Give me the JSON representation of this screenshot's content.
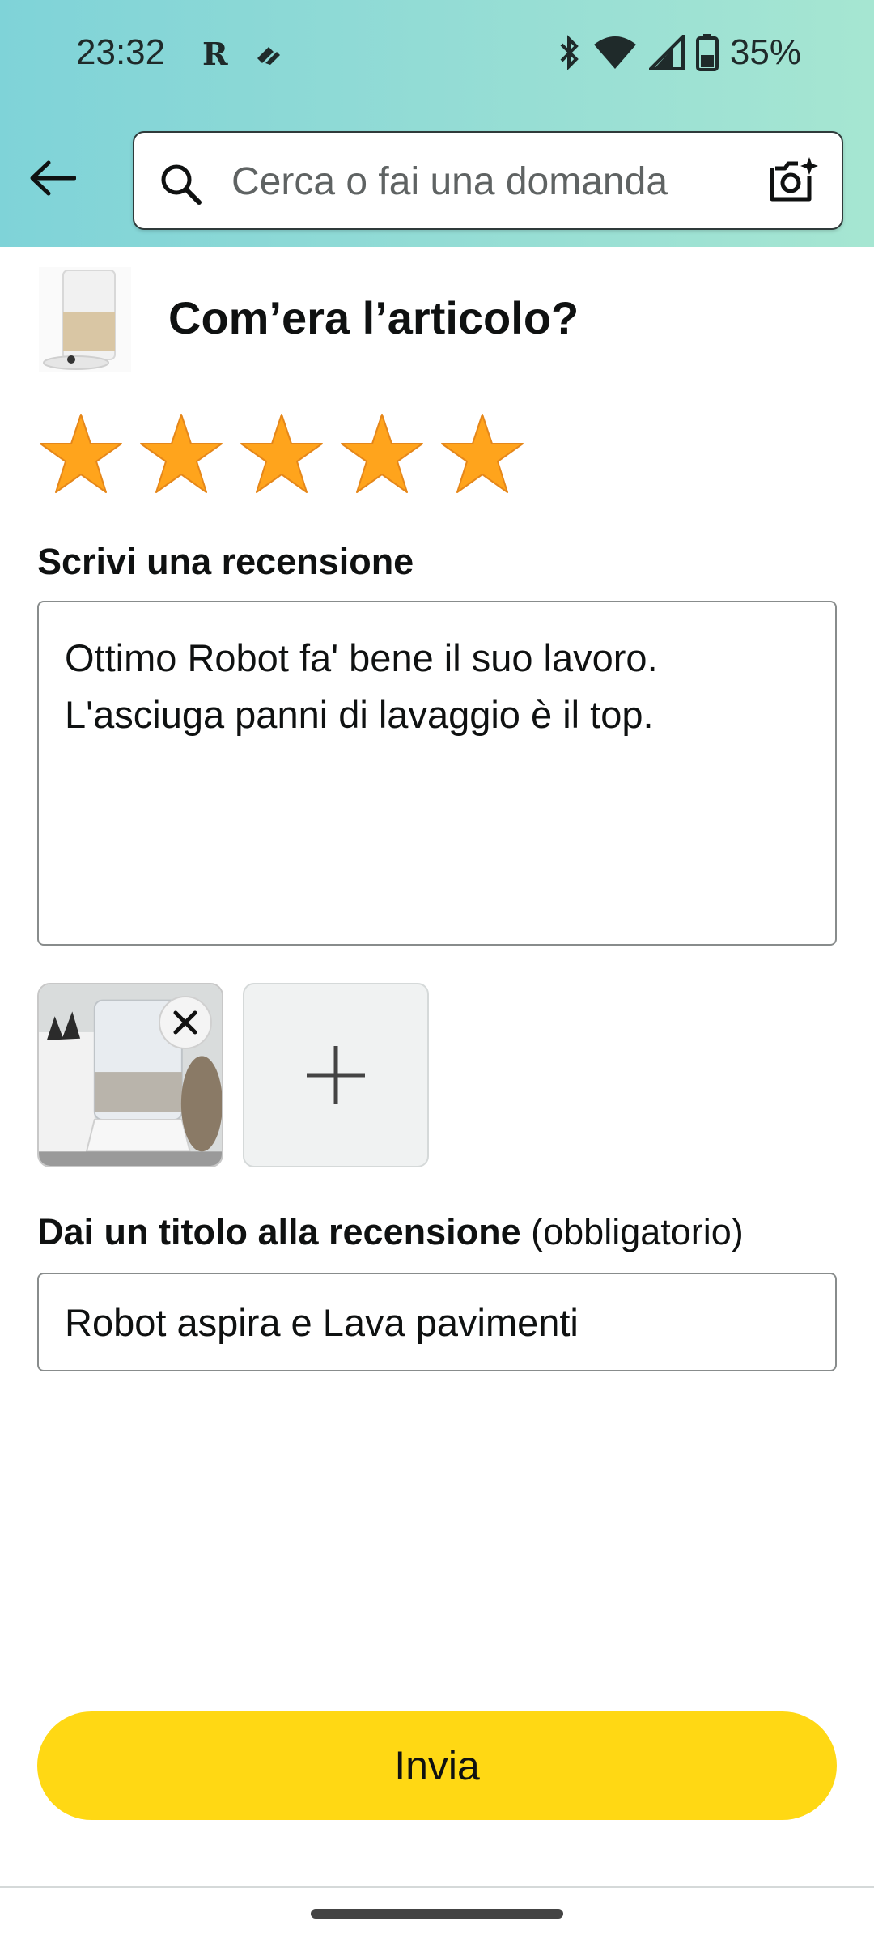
{
  "status_bar": {
    "time": "23:32",
    "battery_percent": "35%",
    "icons": [
      "r-app-icon",
      "notification-icon",
      "bluetooth-icon",
      "wifi-icon",
      "cell-signal-icon",
      "battery-icon"
    ]
  },
  "header": {
    "back_icon": "arrow-left-icon",
    "search_placeholder": "Cerca o fai una domanda",
    "camera_icon": "camera-search-icon"
  },
  "product": {
    "question": "Com’era l’articolo?"
  },
  "rating": {
    "stars_selected": 5,
    "stars_total": 5,
    "star_color": "#ffa41c"
  },
  "review": {
    "label": "Scrivi una recensione",
    "lines": [
      "Ottimo Robot fa' bene il suo lavoro.",
      "L'asciuga panni di lavaggio è il top."
    ]
  },
  "photos": {
    "remove_icon": "close-icon",
    "add_icon": "plus-icon"
  },
  "title_field": {
    "label_bold": "Dai un titolo alla recensione",
    "label_suffix": " (obbligatorio)",
    "value": "Robot aspira e Lava pavimenti"
  },
  "submit": {
    "label": "Invia",
    "color": "#ffd814"
  }
}
